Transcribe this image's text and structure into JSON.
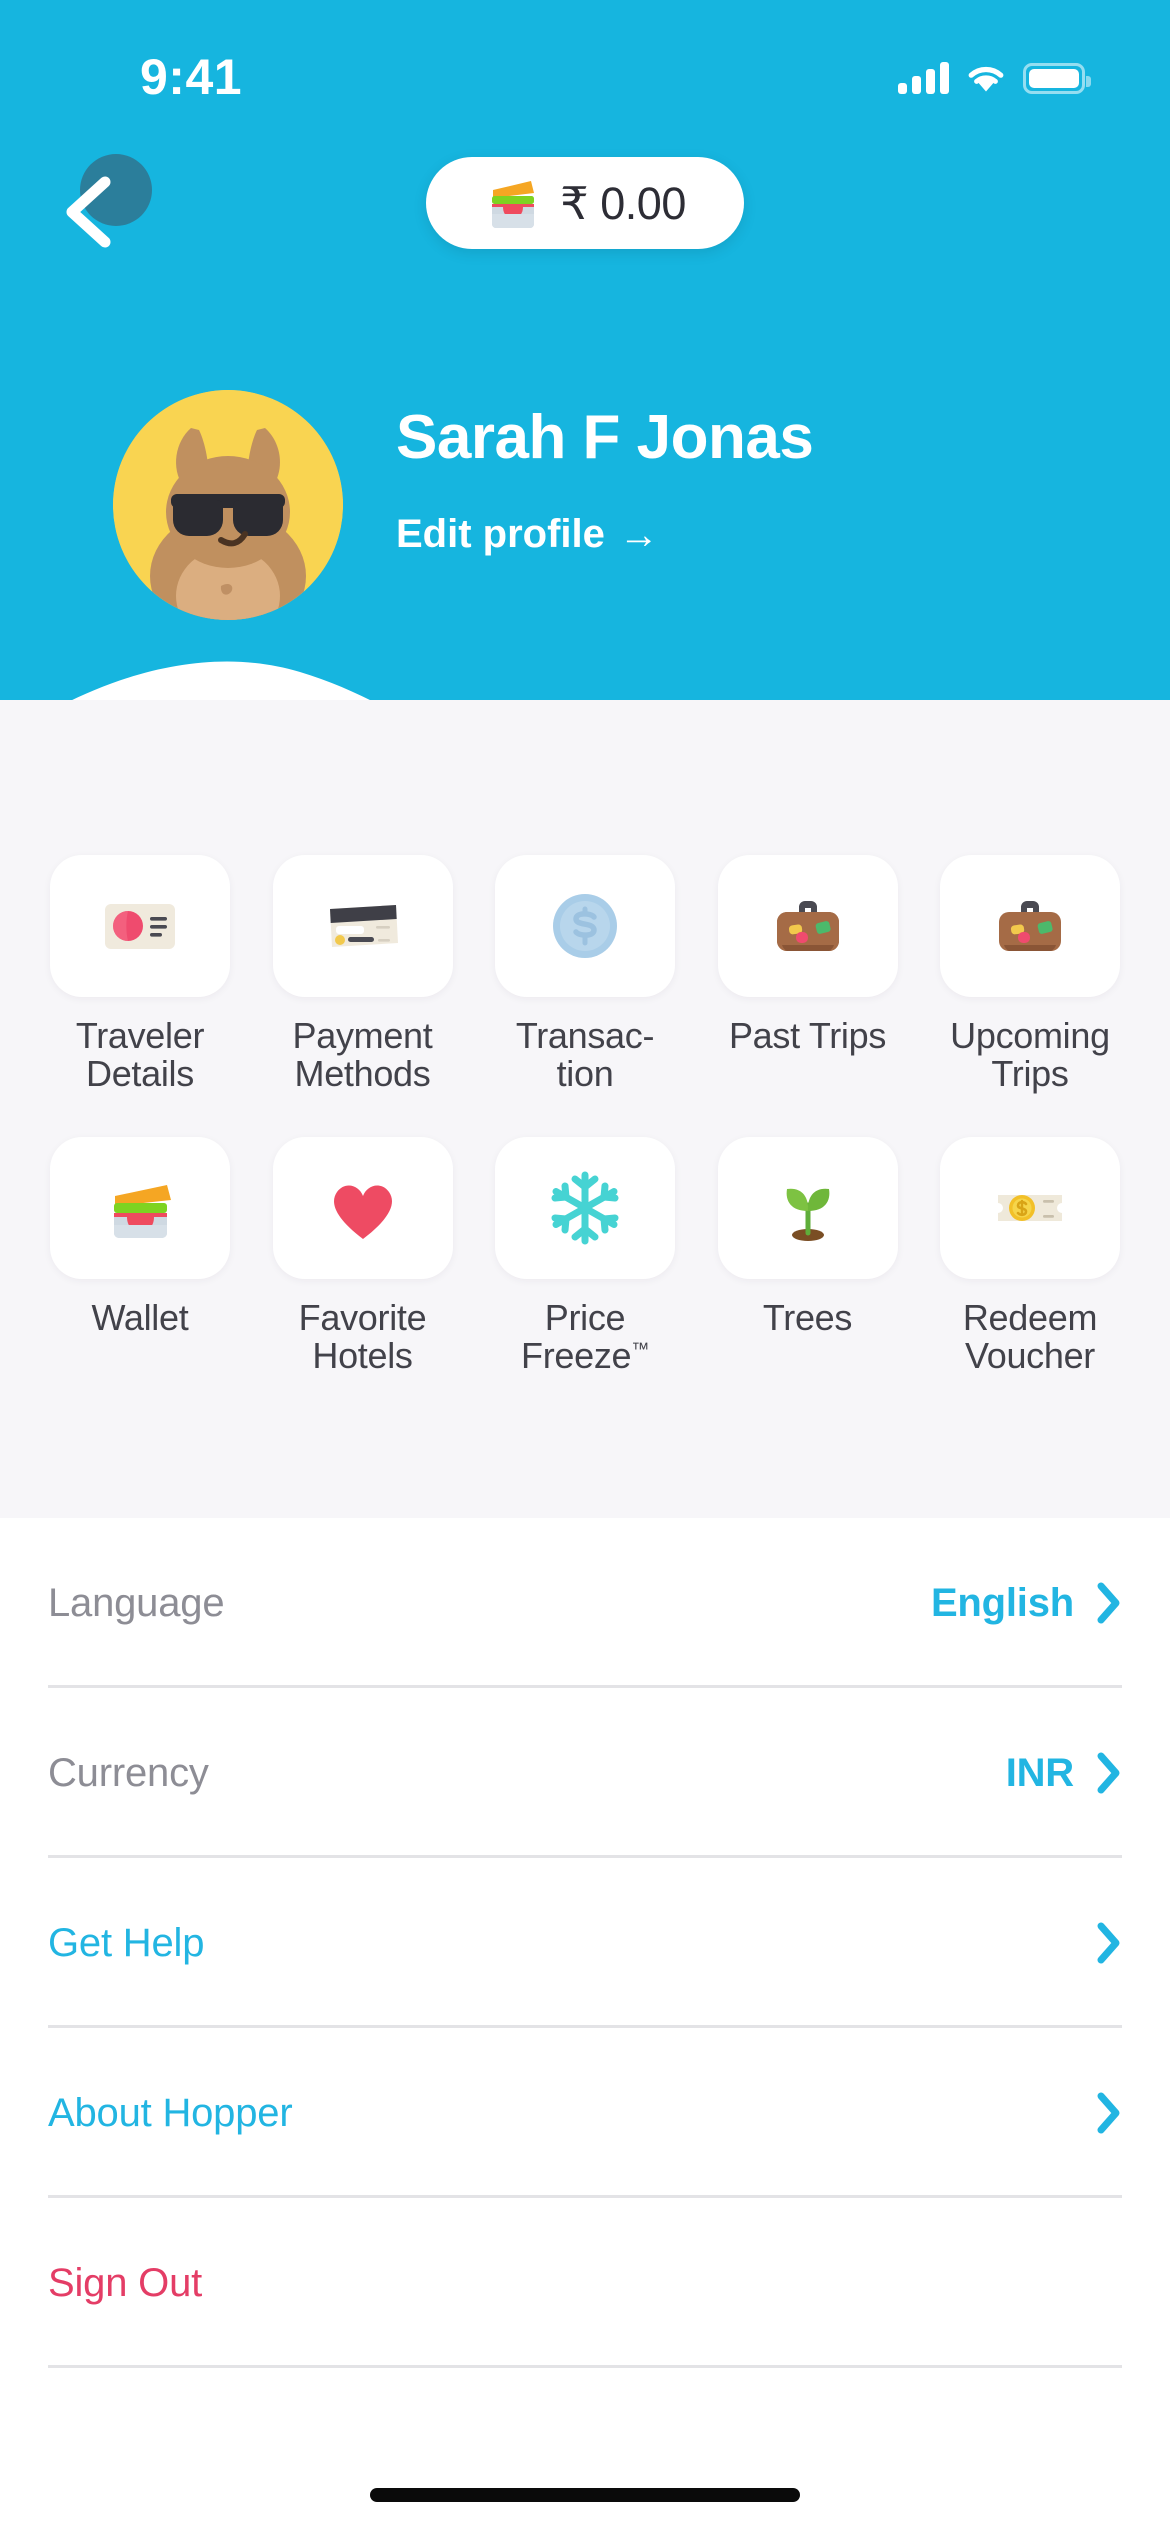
{
  "theme": {
    "brand_cyan": "#16B5DF",
    "hero_blue": "#16B5DF",
    "section_bg": "#F7F6F9",
    "link_cyan": "#22B5E2",
    "danger_pink": "#E43D66",
    "label_gray": "#42424A",
    "muted_gray": "#8D8D95",
    "avatar_yellow": "#F9D451"
  },
  "status_bar": {
    "time": "9:41",
    "signal_icon": "cellular-signal-icon",
    "wifi_icon": "wifi-icon",
    "battery_icon": "battery-full-icon"
  },
  "nav": {
    "back_icon": "back-chevron-icon",
    "wallet_pill": {
      "icon": "wallet-cards-icon",
      "amount": "₹ 0.00"
    }
  },
  "profile": {
    "avatar_icon": "bunny-avatar-with-sunglasses",
    "name": "Sarah F Jonas",
    "edit_label": "Edit profile",
    "edit_arrow": "→"
  },
  "shortcuts": {
    "rows": [
      [
        {
          "label": "Traveler Details",
          "icon": "id-card-icon"
        },
        {
          "label": "Payment Methods",
          "icon": "credit-card-icon"
        },
        {
          "label": "Transac-tion",
          "icon": "dollar-coin-icon"
        },
        {
          "label": "Past Trips",
          "icon": "suitcase-icon"
        },
        {
          "label": "Upcoming Trips",
          "icon": "suitcase-icon"
        }
      ],
      [
        {
          "label": "Wallet",
          "icon": "wallet-cards-icon"
        },
        {
          "label": "Favorite Hotels",
          "icon": "heart-icon"
        },
        {
          "label": "Price Freeze",
          "icon": "snowflake-icon",
          "tm": "™"
        },
        {
          "label": "Trees",
          "icon": "seedling-icon"
        },
        {
          "label": "Redeem Voucher",
          "icon": "money-voucher-icon"
        }
      ]
    ]
  },
  "settings": {
    "rows": [
      {
        "label": "Language",
        "style": "muted",
        "value": "English",
        "chevron": "chevron-right-icon"
      },
      {
        "label": "Currency",
        "style": "muted",
        "value": "INR",
        "chevron": "chevron-right-icon"
      },
      {
        "label": "Get Help",
        "style": "link",
        "value": "",
        "chevron": "chevron-right-icon"
      },
      {
        "label": "About Hopper",
        "style": "link",
        "value": "",
        "chevron": "chevron-right-icon"
      },
      {
        "label": "Sign Out",
        "style": "danger",
        "value": "",
        "chevron": ""
      }
    ]
  },
  "home_indicator": "home-indicator-bar"
}
